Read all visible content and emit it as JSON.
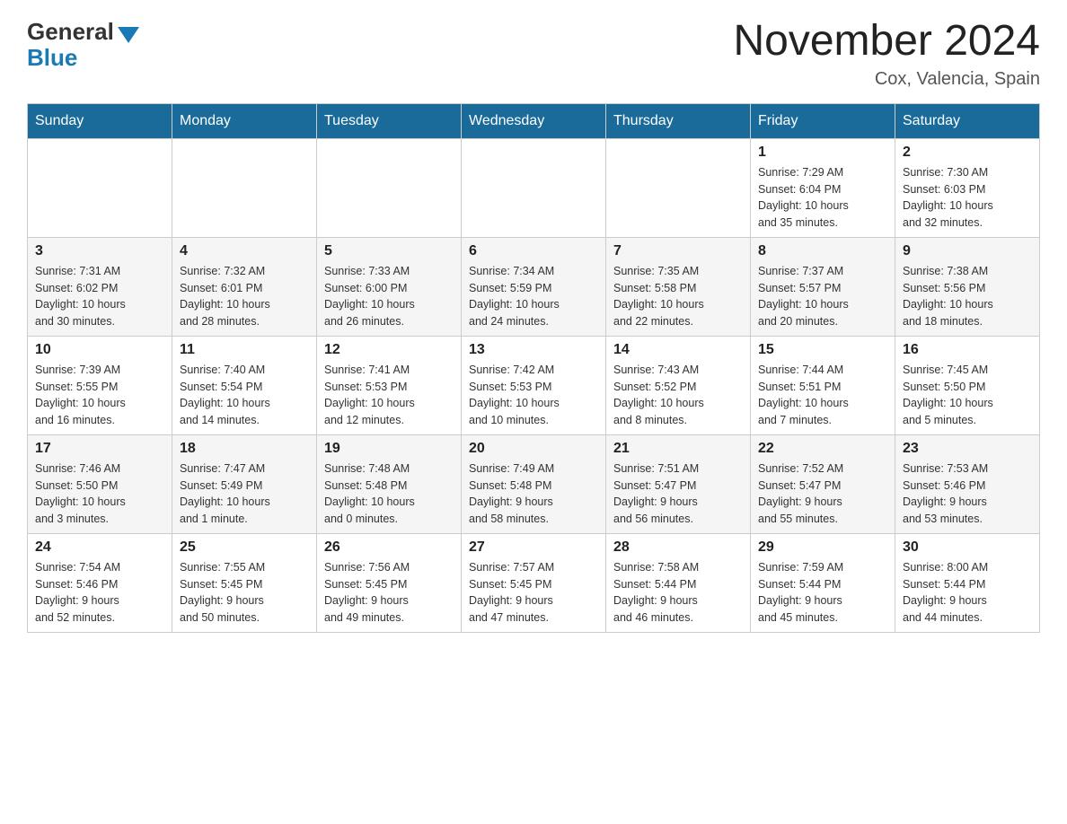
{
  "header": {
    "logo_general": "General",
    "logo_blue": "Blue",
    "month_title": "November 2024",
    "location": "Cox, Valencia, Spain"
  },
  "weekdays": [
    "Sunday",
    "Monday",
    "Tuesday",
    "Wednesday",
    "Thursday",
    "Friday",
    "Saturday"
  ],
  "rows": [
    {
      "cells": [
        {
          "day": "",
          "info": ""
        },
        {
          "day": "",
          "info": ""
        },
        {
          "day": "",
          "info": ""
        },
        {
          "day": "",
          "info": ""
        },
        {
          "day": "",
          "info": ""
        },
        {
          "day": "1",
          "info": "Sunrise: 7:29 AM\nSunset: 6:04 PM\nDaylight: 10 hours\nand 35 minutes."
        },
        {
          "day": "2",
          "info": "Sunrise: 7:30 AM\nSunset: 6:03 PM\nDaylight: 10 hours\nand 32 minutes."
        }
      ]
    },
    {
      "cells": [
        {
          "day": "3",
          "info": "Sunrise: 7:31 AM\nSunset: 6:02 PM\nDaylight: 10 hours\nand 30 minutes."
        },
        {
          "day": "4",
          "info": "Sunrise: 7:32 AM\nSunset: 6:01 PM\nDaylight: 10 hours\nand 28 minutes."
        },
        {
          "day": "5",
          "info": "Sunrise: 7:33 AM\nSunset: 6:00 PM\nDaylight: 10 hours\nand 26 minutes."
        },
        {
          "day": "6",
          "info": "Sunrise: 7:34 AM\nSunset: 5:59 PM\nDaylight: 10 hours\nand 24 minutes."
        },
        {
          "day": "7",
          "info": "Sunrise: 7:35 AM\nSunset: 5:58 PM\nDaylight: 10 hours\nand 22 minutes."
        },
        {
          "day": "8",
          "info": "Sunrise: 7:37 AM\nSunset: 5:57 PM\nDaylight: 10 hours\nand 20 minutes."
        },
        {
          "day": "9",
          "info": "Sunrise: 7:38 AM\nSunset: 5:56 PM\nDaylight: 10 hours\nand 18 minutes."
        }
      ]
    },
    {
      "cells": [
        {
          "day": "10",
          "info": "Sunrise: 7:39 AM\nSunset: 5:55 PM\nDaylight: 10 hours\nand 16 minutes."
        },
        {
          "day": "11",
          "info": "Sunrise: 7:40 AM\nSunset: 5:54 PM\nDaylight: 10 hours\nand 14 minutes."
        },
        {
          "day": "12",
          "info": "Sunrise: 7:41 AM\nSunset: 5:53 PM\nDaylight: 10 hours\nand 12 minutes."
        },
        {
          "day": "13",
          "info": "Sunrise: 7:42 AM\nSunset: 5:53 PM\nDaylight: 10 hours\nand 10 minutes."
        },
        {
          "day": "14",
          "info": "Sunrise: 7:43 AM\nSunset: 5:52 PM\nDaylight: 10 hours\nand 8 minutes."
        },
        {
          "day": "15",
          "info": "Sunrise: 7:44 AM\nSunset: 5:51 PM\nDaylight: 10 hours\nand 7 minutes."
        },
        {
          "day": "16",
          "info": "Sunrise: 7:45 AM\nSunset: 5:50 PM\nDaylight: 10 hours\nand 5 minutes."
        }
      ]
    },
    {
      "cells": [
        {
          "day": "17",
          "info": "Sunrise: 7:46 AM\nSunset: 5:50 PM\nDaylight: 10 hours\nand 3 minutes."
        },
        {
          "day": "18",
          "info": "Sunrise: 7:47 AM\nSunset: 5:49 PM\nDaylight: 10 hours\nand 1 minute."
        },
        {
          "day": "19",
          "info": "Sunrise: 7:48 AM\nSunset: 5:48 PM\nDaylight: 10 hours\nand 0 minutes."
        },
        {
          "day": "20",
          "info": "Sunrise: 7:49 AM\nSunset: 5:48 PM\nDaylight: 9 hours\nand 58 minutes."
        },
        {
          "day": "21",
          "info": "Sunrise: 7:51 AM\nSunset: 5:47 PM\nDaylight: 9 hours\nand 56 minutes."
        },
        {
          "day": "22",
          "info": "Sunrise: 7:52 AM\nSunset: 5:47 PM\nDaylight: 9 hours\nand 55 minutes."
        },
        {
          "day": "23",
          "info": "Sunrise: 7:53 AM\nSunset: 5:46 PM\nDaylight: 9 hours\nand 53 minutes."
        }
      ]
    },
    {
      "cells": [
        {
          "day": "24",
          "info": "Sunrise: 7:54 AM\nSunset: 5:46 PM\nDaylight: 9 hours\nand 52 minutes."
        },
        {
          "day": "25",
          "info": "Sunrise: 7:55 AM\nSunset: 5:45 PM\nDaylight: 9 hours\nand 50 minutes."
        },
        {
          "day": "26",
          "info": "Sunrise: 7:56 AM\nSunset: 5:45 PM\nDaylight: 9 hours\nand 49 minutes."
        },
        {
          "day": "27",
          "info": "Sunrise: 7:57 AM\nSunset: 5:45 PM\nDaylight: 9 hours\nand 47 minutes."
        },
        {
          "day": "28",
          "info": "Sunrise: 7:58 AM\nSunset: 5:44 PM\nDaylight: 9 hours\nand 46 minutes."
        },
        {
          "day": "29",
          "info": "Sunrise: 7:59 AM\nSunset: 5:44 PM\nDaylight: 9 hours\nand 45 minutes."
        },
        {
          "day": "30",
          "info": "Sunrise: 8:00 AM\nSunset: 5:44 PM\nDaylight: 9 hours\nand 44 minutes."
        }
      ]
    }
  ]
}
